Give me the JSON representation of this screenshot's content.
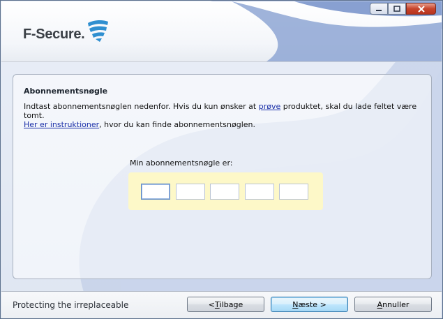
{
  "header": {
    "logo_text": "F-Secure.",
    "window_controls": {
      "minimize": "minimize-icon",
      "maximize": "maximize-icon",
      "close": "close-icon"
    }
  },
  "panel": {
    "title": "Abonnementsnøgle",
    "line1_before_link": "Indtast abonnementsnøglen nedenfor. Hvis du kun ønsker at ",
    "line1_link": "prøve",
    "line1_after_link": " produktet, skal du lade feltet være tomt.",
    "line2_link": "Her er instruktioner",
    "line2_after_link": ", hvor du kan finde abonnementsnøglen.",
    "key_label": "Min abonnementsnøgle er:",
    "key_fields": [
      "",
      "",
      "",
      "",
      ""
    ]
  },
  "footer": {
    "tagline": "Protecting the irreplaceable",
    "back_prefix": "< ",
    "back_mnemonic": "T",
    "back_rest": "ilbage",
    "next_mnemonic": "N",
    "next_rest": "æste >",
    "cancel_mnemonic": "A",
    "cancel_rest": "nnuller"
  },
  "colors": {
    "accent": "#1a2fa8",
    "key_box": "#fdf8c8",
    "swirl": "#a9bbdc",
    "close_button": "#c7442b"
  }
}
